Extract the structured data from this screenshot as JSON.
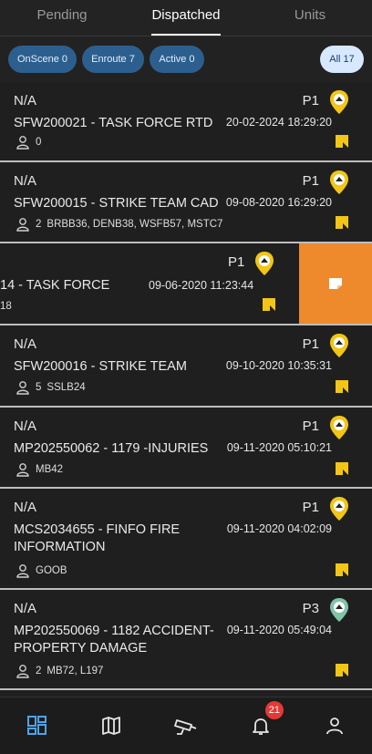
{
  "tabs": [
    {
      "label": "Pending"
    },
    {
      "label": "Dispatched",
      "active": true
    },
    {
      "label": "Units"
    }
  ],
  "filters": {
    "onscene": "OnScene 0",
    "enroute": "Enroute 7",
    "active": "Active 0",
    "all": "All 17"
  },
  "incidents": [
    {
      "location": "N/A",
      "priority": "P1",
      "title": "SFW200021 - TASK FORCE RTD",
      "datetime": "20-02-2024 18:29:20",
      "unit_count": "0",
      "units": ""
    },
    {
      "location": "N/A",
      "priority": "P1",
      "title": "SFW200015 - STRIKE TEAM CAD",
      "datetime": "09-08-2020 16:29:20",
      "unit_count": "2",
      "units": "BRBB36, DENB38, WSFB57, MSTC7"
    },
    {
      "location": "N/A",
      "priority": "P1",
      "title": "SFW200016 - STRIKE TEAM",
      "datetime": "09-10-2020 10:35:31",
      "unit_count": "5",
      "units": "SSLB24"
    },
    {
      "location": "N/A",
      "priority": "P1",
      "title": "MP202550062 - 1179  -INJURIES",
      "datetime": "09-11-2020 05:10:21",
      "unit_count": "",
      "units": "MB42"
    },
    {
      "location": "N/A",
      "priority": "P1",
      "title": "MCS2034655 - FINFO  FIRE INFORMATION",
      "datetime": "09-11-2020 04:02:09",
      "unit_count": "",
      "units": "GOOB"
    },
    {
      "location": "N/A",
      "priority": "P3",
      "title": "MP202550069 - 1182 ACCIDENT- PROPERTY DAMAGE",
      "datetime": "09-11-2020 05:49:04",
      "unit_count": "2",
      "units": "MB72, L197"
    }
  ],
  "swiped": {
    "priority": "P1",
    "title": "14 - TASK FORCE",
    "datetime": "09-06-2020 11:23:44",
    "units": "18"
  },
  "nav": {
    "notifications_badge": "21"
  },
  "colors": {
    "chip": "#2c5f8e",
    "all_chip": "#d7e8ff",
    "swipe_action": "#ee8a2c",
    "note": "#f2c516",
    "pin_p1": "#f2c516",
    "pin_p3": "#7fc4a6",
    "badge": "#e53935"
  }
}
